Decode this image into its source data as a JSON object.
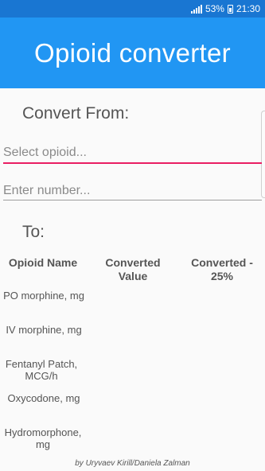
{
  "status_bar": {
    "battery_percent": "53%",
    "time": "21:30"
  },
  "app_bar": {
    "title": "Opioid converter"
  },
  "form": {
    "convert_from_label": "Convert From:",
    "opioid_select_placeholder": "Select opioid...",
    "number_placeholder": "Enter number...",
    "to_label": "To:"
  },
  "table": {
    "headers": [
      "Opioid Name",
      "Converted Value",
      "Converted - 25%"
    ],
    "rows": [
      {
        "name": "PO morphine, mg",
        "converted": "",
        "converted_25": ""
      },
      {
        "name": "IV morphine, mg",
        "converted": "",
        "converted_25": ""
      },
      {
        "name": "Fentanyl Patch, MCG/h",
        "converted": "",
        "converted_25": ""
      },
      {
        "name": "Oxycodone, mg",
        "converted": "",
        "converted_25": ""
      },
      {
        "name": "Hydromorphone, mg",
        "converted": "",
        "converted_25": ""
      }
    ]
  },
  "footer": {
    "credits": "by Uryvaev Kirill/Daniela Zalman"
  },
  "colors": {
    "status_bar": "#1976d2",
    "app_bar": "#2196f3",
    "accent_underline": "#e91e63",
    "text": "#555555"
  }
}
